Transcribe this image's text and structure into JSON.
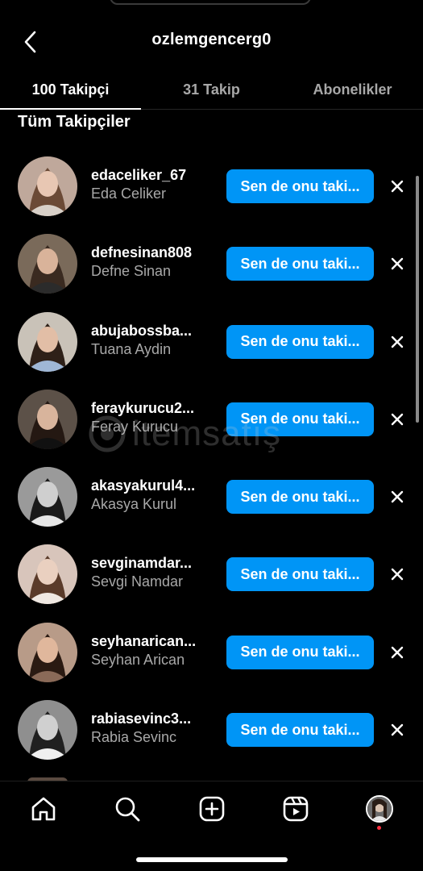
{
  "header": {
    "title": "ozlemgencerg0"
  },
  "tabs": [
    {
      "label": "100 Takipçi",
      "active": true
    },
    {
      "label": "31 Takip",
      "active": false
    },
    {
      "label": "Abonelikler",
      "active": false
    }
  ],
  "section_title": "Tüm Takipçiler",
  "followers": [
    {
      "username": "edaceliker_67",
      "full_name": "Eda Celiker",
      "button": "Sen de onu taki..."
    },
    {
      "username": "defnesinan808",
      "full_name": "Defne Sinan",
      "button": "Sen de onu taki..."
    },
    {
      "username": "abujabossba...",
      "full_name": "Tuana Aydin",
      "button": "Sen de onu taki..."
    },
    {
      "username": "feraykurucu2...",
      "full_name": "Feray Kurucu",
      "button": "Sen de onu taki..."
    },
    {
      "username": "akasyakurul4...",
      "full_name": "Akasya Kurul",
      "button": "Sen de onu taki..."
    },
    {
      "username": "sevginamdar...",
      "full_name": "Sevgi Namdar",
      "button": "Sen de onu taki..."
    },
    {
      "username": "seyhanarican...",
      "full_name": "Seyhan Arican",
      "button": "Sen de onu taki..."
    },
    {
      "username": "rabiasevinc3...",
      "full_name": "Rabia Sevinc",
      "button": "Sen de onu taki..."
    }
  ],
  "watermark": "itemsatış",
  "bottom_nav": [
    {
      "icon": "home-icon"
    },
    {
      "icon": "search-icon"
    },
    {
      "icon": "create-icon"
    },
    {
      "icon": "reels-icon"
    },
    {
      "icon": "profile-avatar"
    }
  ],
  "colors": {
    "background": "#000000",
    "accent": "#0095f6",
    "secondary_text": "#a8a8a8",
    "notification": "#ff3040"
  }
}
